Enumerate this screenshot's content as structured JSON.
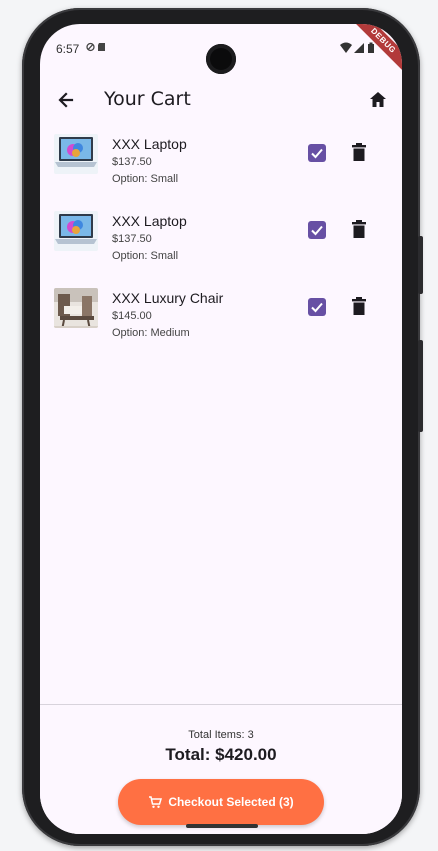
{
  "status_bar": {
    "time": "6:57",
    "left_icons": [
      "data-saver-icon",
      "sim-icon"
    ],
    "right_icons": [
      "wifi-icon",
      "signal-icon",
      "battery-icon"
    ],
    "debug_banner": "DEBUG"
  },
  "app_bar": {
    "title": "Your Cart",
    "back_icon": "arrow-back-icon",
    "home_icon": "home-icon"
  },
  "cart": {
    "items": [
      {
        "name": "XXX Laptop",
        "price": "$137.50",
        "option": "Option: Small",
        "thumbnail": "laptop",
        "checked": true
      },
      {
        "name": "XXX Laptop",
        "price": "$137.50",
        "option": "Option: Small",
        "thumbnail": "laptop",
        "checked": true
      },
      {
        "name": "XXX Luxury Chair",
        "price": "$145.00",
        "option": "Option: Medium",
        "thumbnail": "chair",
        "checked": true
      }
    ]
  },
  "summary": {
    "total_items": "Total Items: 3",
    "total": "Total: $420.00",
    "checkout_label": "Checkout Selected (3)",
    "checkout_icon": "cart-icon"
  },
  "colors": {
    "background": "#fdf7ff",
    "checkbox": "#6750a4",
    "checkout_button": "#ff7043"
  }
}
